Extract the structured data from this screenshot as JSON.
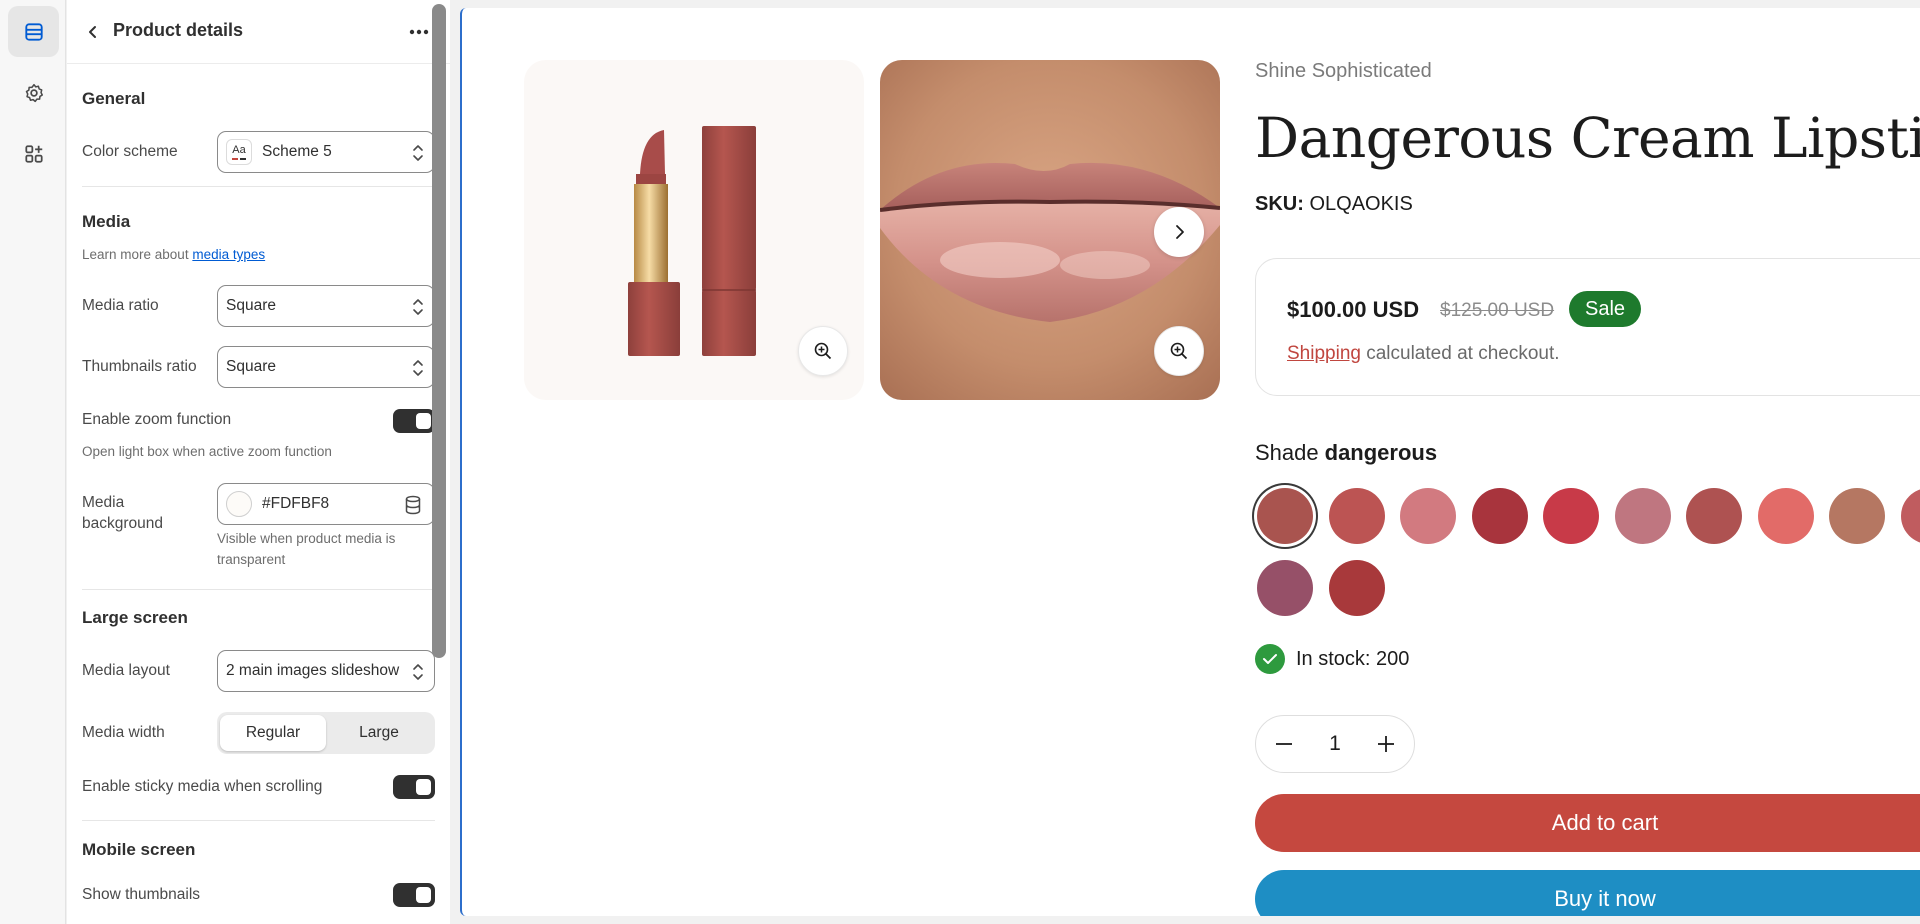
{
  "panel": {
    "title": "Product details",
    "general": {
      "title": "General",
      "color_scheme_label": "Color scheme",
      "color_scheme_value": "Scheme 5",
      "color_scheme_icon_text": "Aa"
    },
    "media": {
      "title": "Media",
      "help_text": "Learn more about",
      "help_link": "media types",
      "ratio_label": "Media ratio",
      "ratio_value": "Square",
      "thumbs_ratio_label": "Thumbnails ratio",
      "thumbs_ratio_value": "Square",
      "zoom_label": "Enable zoom function",
      "zoom_enabled": true,
      "zoom_help": "Open light box when active zoom function",
      "background_label_1": "Media",
      "background_label_2": "background",
      "background_value": "#FDFBF8",
      "background_help": "Visible when product media is transparent"
    },
    "large_screen": {
      "title": "Large screen",
      "layout_label": "Media layout",
      "layout_value": "2 main images slideshow",
      "width_label": "Media width",
      "width_options": [
        "Regular",
        "Large"
      ],
      "width_selected": "Regular",
      "sticky_label": "Enable sticky media when scrolling",
      "sticky_enabled": true
    },
    "mobile_screen": {
      "title": "Mobile screen",
      "thumbs_label": "Show thumbnails",
      "thumbs_enabled": true
    }
  },
  "product": {
    "vendor": "Shine Sophisticated",
    "title": "Dangerous Cream Lipstick",
    "sku_label": "SKU:",
    "sku_value": "OLQAOKIS",
    "price": "$100.00 USD",
    "compare_price": "$125.00 USD",
    "sale_badge": "Sale",
    "shipping_link": "Shipping",
    "shipping_text": "calculated at checkout.",
    "shade_label": "Shade",
    "shade_value": "dangerous",
    "shades": [
      "#a9544f",
      "#bc5453",
      "#d27a80",
      "#a8343d",
      "#c83a48",
      "#bf7680",
      "#ae5251",
      "#e26b68",
      "#b57762",
      "#c05c5f",
      "#965068",
      "#a8393b"
    ],
    "stock_text": "In stock: 200",
    "quantity": "1",
    "add_to_cart": "Add to cart",
    "buy_now": "Buy it now"
  },
  "colors": {
    "accent": "#005bd3",
    "sale": "#1e7a2d",
    "cart": "#c5483f",
    "buy": "#1e8ec4"
  }
}
